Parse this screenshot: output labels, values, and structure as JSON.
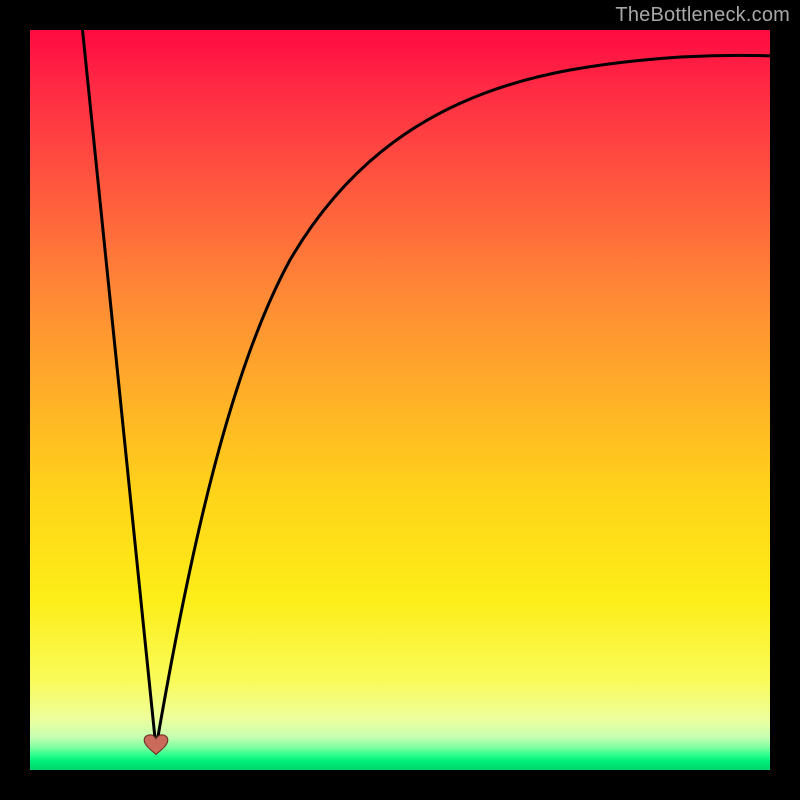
{
  "watermark": {
    "text": "TheBottleneck.com"
  },
  "colors": {
    "black": "#000000",
    "curve": "#000000",
    "heart_fill": "#c96a5a",
    "heart_stroke": "#6e2f24",
    "watermark": "#a8a8a8",
    "gradient_top": "#ff0a42",
    "gradient_bottom": "#00d66c"
  },
  "chart_data": {
    "type": "line",
    "title": "",
    "subtitle": "",
    "xlabel": "",
    "ylabel": "",
    "xlim": [
      0,
      100
    ],
    "ylim": [
      0,
      100
    ],
    "grid": false,
    "legend": false,
    "annotations": [
      {
        "name": "minimum-marker-heart",
        "x": 17,
        "y": 2
      }
    ],
    "series": [
      {
        "name": "left-branch",
        "x": [
          7,
          8,
          9,
          10,
          11,
          12,
          13,
          14,
          15,
          16,
          17
        ],
        "values": [
          100,
          90,
          80,
          70,
          60,
          50,
          40,
          30,
          20,
          10,
          2
        ]
      },
      {
        "name": "right-branch",
        "x": [
          17,
          19,
          21,
          24,
          27,
          31,
          36,
          42,
          50,
          60,
          72,
          85,
          100
        ],
        "values": [
          2,
          12,
          22,
          34,
          44,
          54,
          63,
          71,
          78,
          84,
          89,
          92,
          94
        ]
      }
    ]
  }
}
